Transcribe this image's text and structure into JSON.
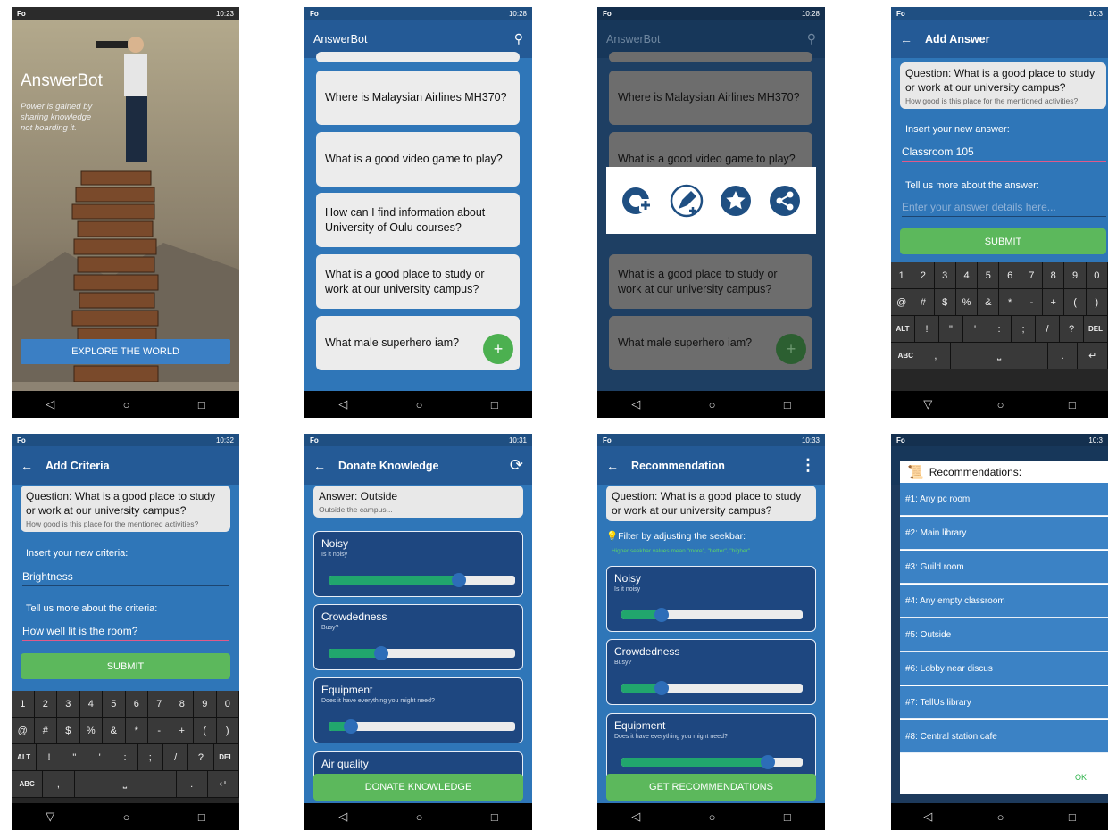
{
  "status": {
    "left1": "Fo",
    "time1": "10:23",
    "time2": "10:28",
    "time3": "10:28",
    "time4": "10:3",
    "time5": "10:32",
    "time6": "10:31",
    "time7": "10:33",
    "time8": "10:3"
  },
  "splash": {
    "app_name": "AnswerBot",
    "tagline": "Power is gained by sharing knowledge not hoarding it.",
    "explore": "EXPLORE THE WORLD"
  },
  "list": {
    "title": "AnswerBot",
    "questions": [
      "Where is Malaysian Airlines MH370?",
      "What is a good video game to play?",
      "How can I find information about University of Oulu courses?",
      "What is a good place to study or work at our university campus?",
      "What male superhero iam?"
    ],
    "fab": "+"
  },
  "overlay": {
    "title": "AnswerBot",
    "questions": [
      "Where is Malaysian Airlines MH370?",
      "What is a good video game to play?",
      "What is a good place to study or work at our university campus?",
      "What male superhero iam?"
    ]
  },
  "add_answer": {
    "title": "Add Answer",
    "question": "Question: What is a good place to study or work at our university campus?",
    "sub": "How good is this place for the mentioned activities?",
    "insert_label": "Insert your new answer:",
    "answer_value": "Classroom 105",
    "more_label": "Tell us more about the answer:",
    "details_placeholder": "Enter your answer details here...",
    "submit": "SUBMIT"
  },
  "add_criteria": {
    "title": "Add Criteria",
    "question": "Question: What is a good place to study or work at our university campus?",
    "sub": "How good is this place for the mentioned activities?",
    "insert_label": "Insert your new criteria:",
    "criteria_value": "Brightness",
    "more_label": "Tell us more about the criteria:",
    "more_value": "How well lit is the room?",
    "submit": "SUBMIT"
  },
  "keyboard": {
    "row1": [
      "1",
      "2",
      "3",
      "4",
      "5",
      "6",
      "7",
      "8",
      "9",
      "0"
    ],
    "row2": [
      "@",
      "#",
      "$",
      "%",
      "&",
      "*",
      "-",
      "+",
      "(",
      ")"
    ],
    "row3": [
      "ALT",
      "!",
      "\"",
      "'",
      ":",
      ";",
      "/",
      "?",
      "DEL"
    ],
    "row4": [
      "ABC",
      ",",
      "",
      ".",
      " ↵"
    ]
  },
  "donate": {
    "title": "Donate Knowledge",
    "answer": "Answer: Outside",
    "answer_sub": "Outside the campus...",
    "criteria": [
      {
        "name": "Noisy",
        "desc": "Is it noisy",
        "level": 0.7
      },
      {
        "name": "Crowdedness",
        "desc": "Busy?",
        "level": 0.28
      },
      {
        "name": "Equipment",
        "desc": "Does it have everything you might need?",
        "level": 0.12
      },
      {
        "name": "Air quality",
        "desc": "",
        "level": 0
      }
    ],
    "button": "DONATE KNOWLEDGE"
  },
  "recommend": {
    "title": "Recommendation",
    "question": "Question: What is a good place to study or work at our university campus?",
    "filter": "Filter by adjusting the seekbar:",
    "hint": "Higher seekbar values mean \"more\", \"better\", \"higher\"",
    "criteria": [
      {
        "name": "Noisy",
        "desc": "Is it noisy",
        "level": 0.22
      },
      {
        "name": "Crowdedness",
        "desc": "Busy?",
        "level": 0.22
      },
      {
        "name": "Equipment",
        "desc": "Does it have everything you might need?",
        "level": 0.81
      }
    ],
    "button": "GET RECOMMENDATIONS"
  },
  "results": {
    "title": "Recommendations:",
    "items": [
      "#1: Any pc room",
      "#2: Main library",
      "#3: Guild room",
      "#4: Any empty classroom",
      "#5: Outside",
      "#6: Lobby near discus",
      "#7: TellUs library",
      "#8: Central station cafe"
    ],
    "ok": "OK"
  }
}
